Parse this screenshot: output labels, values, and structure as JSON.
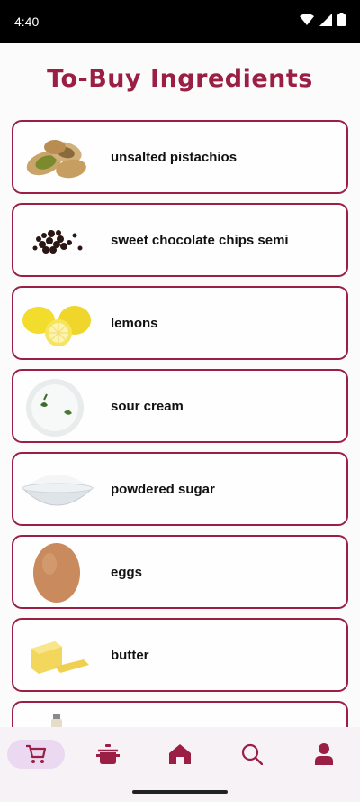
{
  "status": {
    "time": "4:40"
  },
  "title": "To-Buy Ingredients",
  "ingredients": [
    {
      "name": "unsalted pistachios",
      "image": "pistachios-image"
    },
    {
      "name": "sweet chocolate chips semi",
      "image": "chocolate-chips-image"
    },
    {
      "name": "lemons",
      "image": "lemons-image"
    },
    {
      "name": "sour cream",
      "image": "sour-cream-image"
    },
    {
      "name": "powdered sugar",
      "image": "powdered-sugar-image"
    },
    {
      "name": "eggs",
      "image": "egg-image"
    },
    {
      "name": "butter",
      "image": "butter-image"
    },
    {
      "name": "",
      "image": "spice-bottle-image"
    }
  ],
  "nav": [
    {
      "icon": "cart-icon",
      "active": true
    },
    {
      "icon": "pot-icon",
      "active": false
    },
    {
      "icon": "home-icon",
      "active": false
    },
    {
      "icon": "search-icon",
      "active": false
    },
    {
      "icon": "profile-icon",
      "active": false
    }
  ],
  "colors": {
    "accent": "#9b1e45",
    "nav_active": "#ead9f0",
    "nav_bg": "#f6f2f5"
  }
}
